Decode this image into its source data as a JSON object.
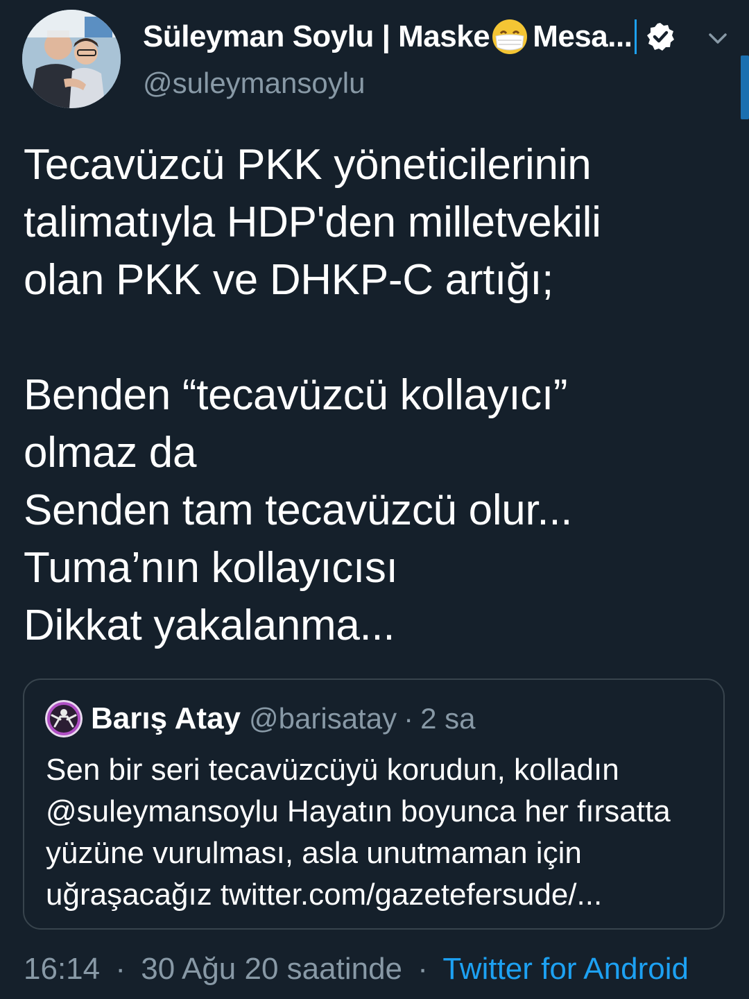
{
  "tweet": {
    "author": {
      "display_name": "Süleyman Soylu | Maske",
      "display_name_suffix": "Mesa...",
      "handle": "@suleymansoylu",
      "verified": true,
      "emoji": "face-with-medical-mask"
    },
    "text": "Tecavüzcü PKK yöneticilerinin\ntalimatıyla HDP'den milletvekili\nolan PKK ve DHKP-C artığı;\n\nBenden “tecavüzcü kollayıcı”\nolmaz da\nSenden tam tecavüzcü olur...\nTuma’nın kollayıcısı\nDikkat yakalanma...",
    "quoted": {
      "display_name": "Barış Atay",
      "handle": "@barisatay",
      "separator": "·",
      "time": "2 sa",
      "text": "Sen bir seri tecavüzcüyü korudun, kolladın @suleymansoylu Hayatın boyunca her fırsatta yüzüne vurulması, asla unutmaman için uğraşacağız twitter.com/gazetefersude/..."
    },
    "meta": {
      "time": "16:14",
      "separator": "·",
      "date": "30 Ağu 20 saatinde",
      "separator2": "·",
      "source": "Twitter for Android"
    }
  },
  "colors": {
    "background": "#15202b",
    "text": "#ffffff",
    "secondary_text": "#8899a6",
    "accent": "#1da1f2",
    "border": "#38444d"
  },
  "icons": {
    "verified": "verified-badge-icon",
    "menu": "chevron-down-icon"
  }
}
